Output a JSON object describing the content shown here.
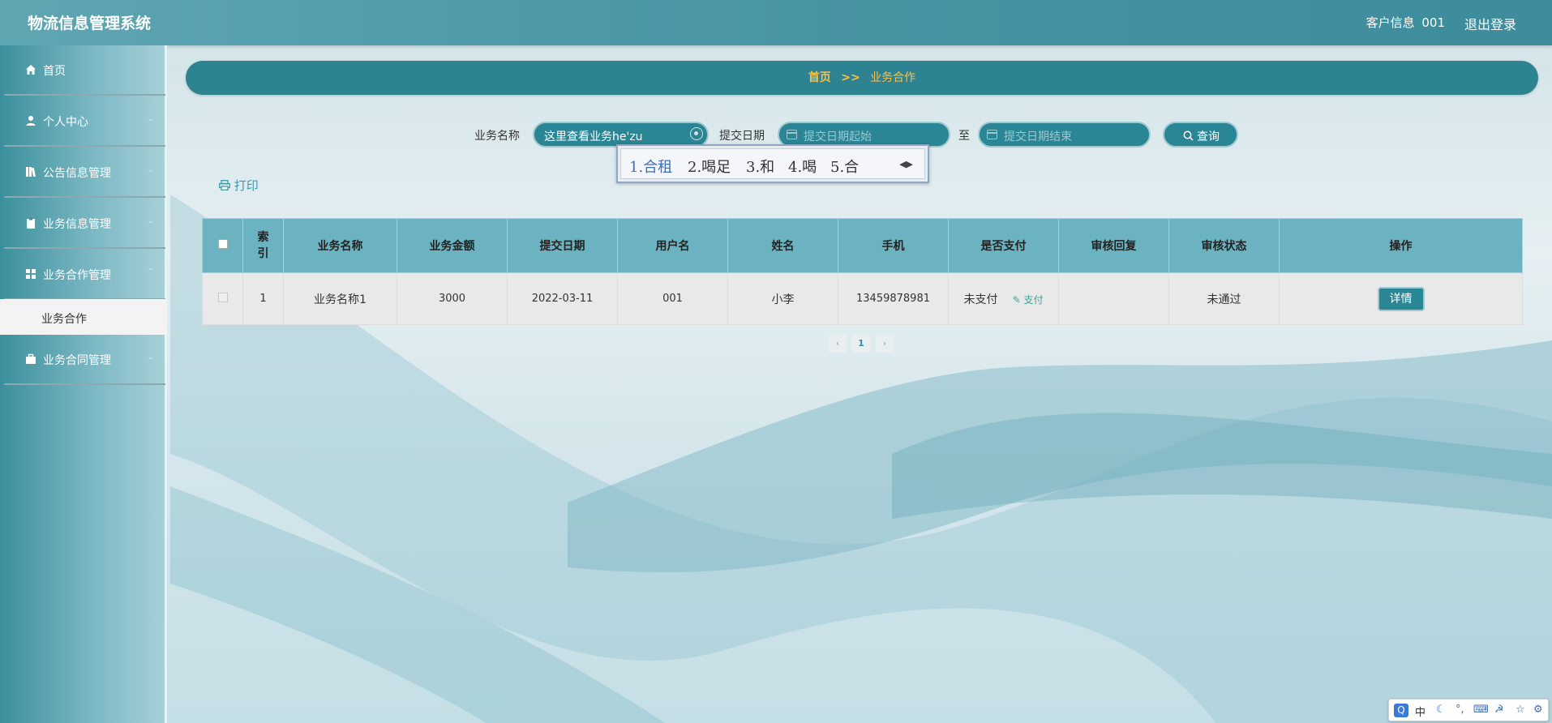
{
  "app": {
    "title": "物流信息管理系统",
    "user_label": "客户信息",
    "user_id": "001",
    "logout": "退出登录"
  },
  "sidebar": {
    "items": [
      {
        "label": "首页",
        "icon": "home-icon"
      },
      {
        "label": "个人中心",
        "icon": "user-icon"
      },
      {
        "label": "公告信息管理",
        "icon": "book-icon"
      },
      {
        "label": "业务信息管理",
        "icon": "clipboard-icon"
      },
      {
        "label": "业务合作管理",
        "icon": "grid-icon"
      },
      {
        "label": "业务合同管理",
        "icon": "briefcase-icon"
      }
    ],
    "sub_item": "业务合作"
  },
  "breadcrumb": {
    "home": "首页",
    "separator": ">>",
    "current": "业务合作"
  },
  "search": {
    "name_label": "业务名称",
    "name_value": "这里查看业务he'zu",
    "date_label": "提交日期",
    "date_start_placeholder": "提交日期起始",
    "to_label": "至",
    "date_end_placeholder": "提交日期结束",
    "button": "查询"
  },
  "ime": {
    "candidates": [
      "1.合租",
      "2.喝足",
      "3.和",
      "4.喝",
      "5.合"
    ]
  },
  "toolbar": {
    "print": "打印"
  },
  "table": {
    "headers": [
      "索引",
      "业务名称",
      "业务金额",
      "提交日期",
      "用户名",
      "姓名",
      "手机",
      "是否支付",
      "审核回复",
      "审核状态",
      "操作"
    ],
    "rows": [
      {
        "index": "1",
        "name": "业务名称1",
        "amount": "3000",
        "date": "2022-03-11",
        "username": "001",
        "realname": "小李",
        "phone": "13459878981",
        "paid": "未支付",
        "pay_action": "支付",
        "reply": "",
        "status": "未通过",
        "action": "详情"
      }
    ]
  },
  "pagination": {
    "current": "1"
  },
  "imebar": {
    "mode": "中"
  },
  "colors": {
    "header": "#4b97a6",
    "accent": "#2a8595",
    "breadcrumb_text": "#f6c14b",
    "table_header": "#6bb3c0"
  }
}
